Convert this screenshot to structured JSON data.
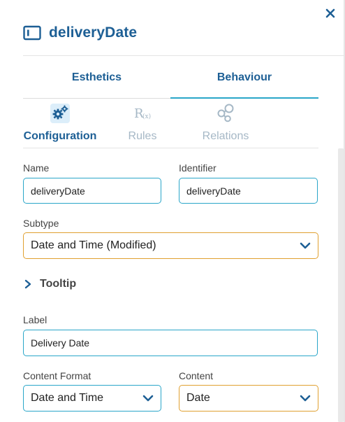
{
  "header": {
    "title": "deliveryDate"
  },
  "main_tabs": [
    {
      "label": "Esthetics",
      "active": false
    },
    {
      "label": "Behaviour",
      "active": true
    }
  ],
  "sub_tabs": [
    {
      "label": "Configuration",
      "icon": "gears-icon",
      "active": true
    },
    {
      "label": "Rules",
      "icon": "rules-icon",
      "active": false
    },
    {
      "label": "Relations",
      "icon": "relations-icon",
      "active": false
    }
  ],
  "form": {
    "name": {
      "label": "Name",
      "value": "deliveryDate"
    },
    "identifier": {
      "label": "Identifier",
      "value": "deliveryDate"
    },
    "subtype": {
      "label": "Subtype",
      "value": "Date and Time (Modified)"
    },
    "tooltip": {
      "label": "Tooltip"
    },
    "label_field": {
      "label": "Label",
      "value": "Delivery Date"
    },
    "content_format": {
      "label": "Content Format",
      "value": "Date and Time"
    },
    "content": {
      "label": "Content",
      "value": "Date"
    }
  },
  "colors": {
    "primary_text": "#1d5f95",
    "accent": "#2aa6c9",
    "warning_border": "#e0a030",
    "inactive_text": "#a6b8c6"
  }
}
